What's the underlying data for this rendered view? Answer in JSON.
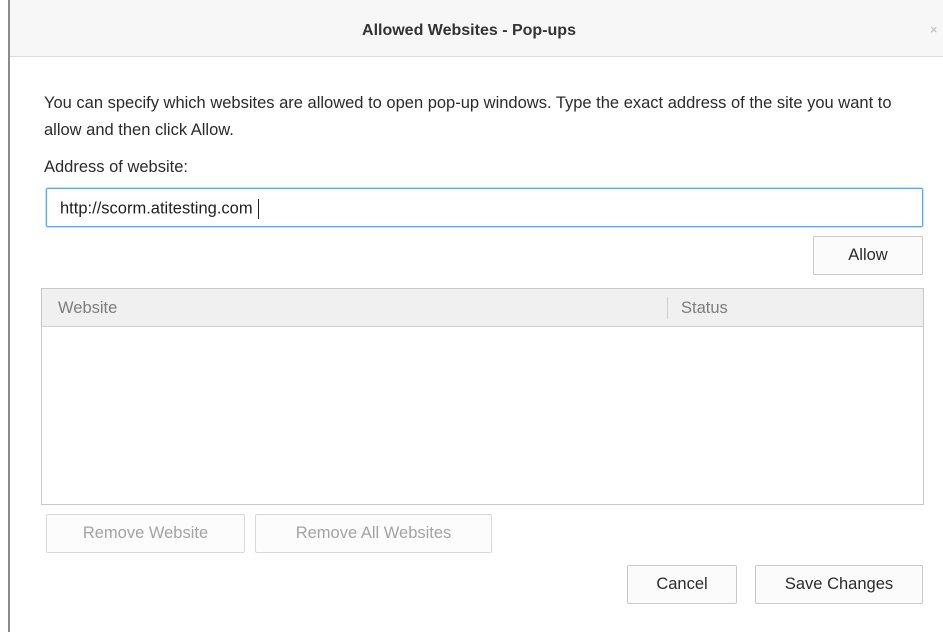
{
  "dialog": {
    "title": "Allowed Websites - Pop-ups",
    "close_glyph": "×",
    "description": "You can specify which websites are allowed to open pop-up windows. Type the exact address of the site you want to allow and then click Allow.",
    "address_label": "Address of website:",
    "address_value": "http://scorm.atitesting.com",
    "allow_label": "Allow"
  },
  "table": {
    "columns": [
      "Website",
      "Status"
    ],
    "rows": []
  },
  "actions": {
    "remove_website_label": "Remove Website",
    "remove_all_label": "Remove All Websites",
    "cancel_label": "Cancel",
    "save_label": "Save Changes"
  },
  "colors": {
    "focus_border": "#6aa6dc",
    "disabled_text": "#a3a3a3",
    "header_bg": "#f0f0f0"
  }
}
